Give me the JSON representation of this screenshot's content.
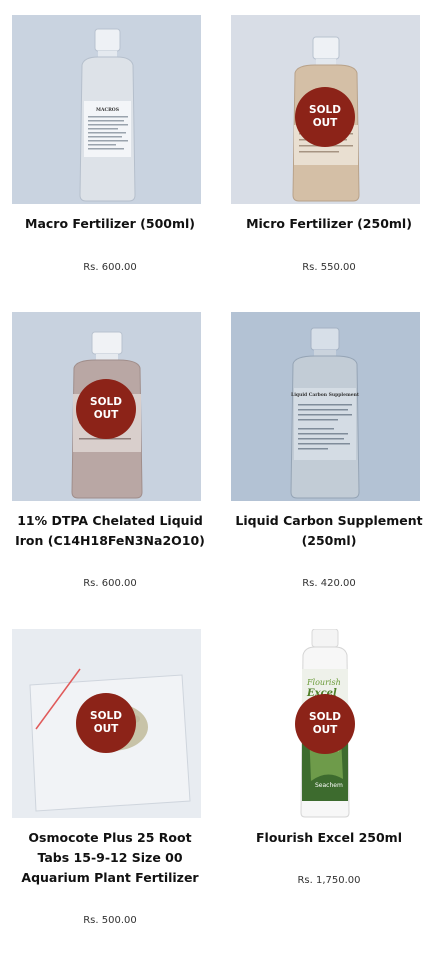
{
  "products": [
    {
      "name": "Macro Fertilizer (500ml)",
      "price": "Rs. 600.00",
      "sold_out": false,
      "image": {
        "kind": "bottle",
        "bg": "#c9d3e0",
        "liquid": "#dde2e8",
        "label_title": "MACROS"
      }
    },
    {
      "name": "Micro Fertilizer (250ml)",
      "price": "Rs. 550.00",
      "sold_out": true,
      "image": {
        "kind": "bottle",
        "bg": "#d8dde6",
        "liquid": "#d4bfa6",
        "label_title": ""
      }
    },
    {
      "name": "11% DTPA Chelated Liquid Iron (C14H18FeN3Na2O10)",
      "price": "Rs. 600.00",
      "sold_out": true,
      "image": {
        "kind": "bottle",
        "bg": "#c8d2df",
        "liquid": "#b9a7a4",
        "label_title": ""
      }
    },
    {
      "name": "Liquid Carbon Supplement (250ml)",
      "price": "Rs. 420.00",
      "sold_out": false,
      "image": {
        "kind": "bottle",
        "bg": "#b3c2d4",
        "liquid": "#c2ccd6",
        "label_title": "Liquid Carbon Supplement"
      }
    },
    {
      "name": "Osmocote Plus 25 Root Tabs 15-9-12 Size 00 Aquarium Plant Fertilizer",
      "price": "Rs. 500.00",
      "sold_out": true,
      "image": {
        "kind": "bag",
        "bg": "#e8ecf1"
      }
    },
    {
      "name": "Flourish Excel 250ml",
      "price": "Rs. 1,750.00",
      "sold_out": true,
      "image": {
        "kind": "seachem",
        "bg": "#ffffff",
        "brand_line1": "Flourish",
        "brand_line2": "Excel",
        "maker": "Seachem"
      }
    }
  ],
  "badge_label_line1": "SOLD",
  "badge_label_line2": "OUT",
  "colors": {
    "badge": "#8c2318"
  }
}
